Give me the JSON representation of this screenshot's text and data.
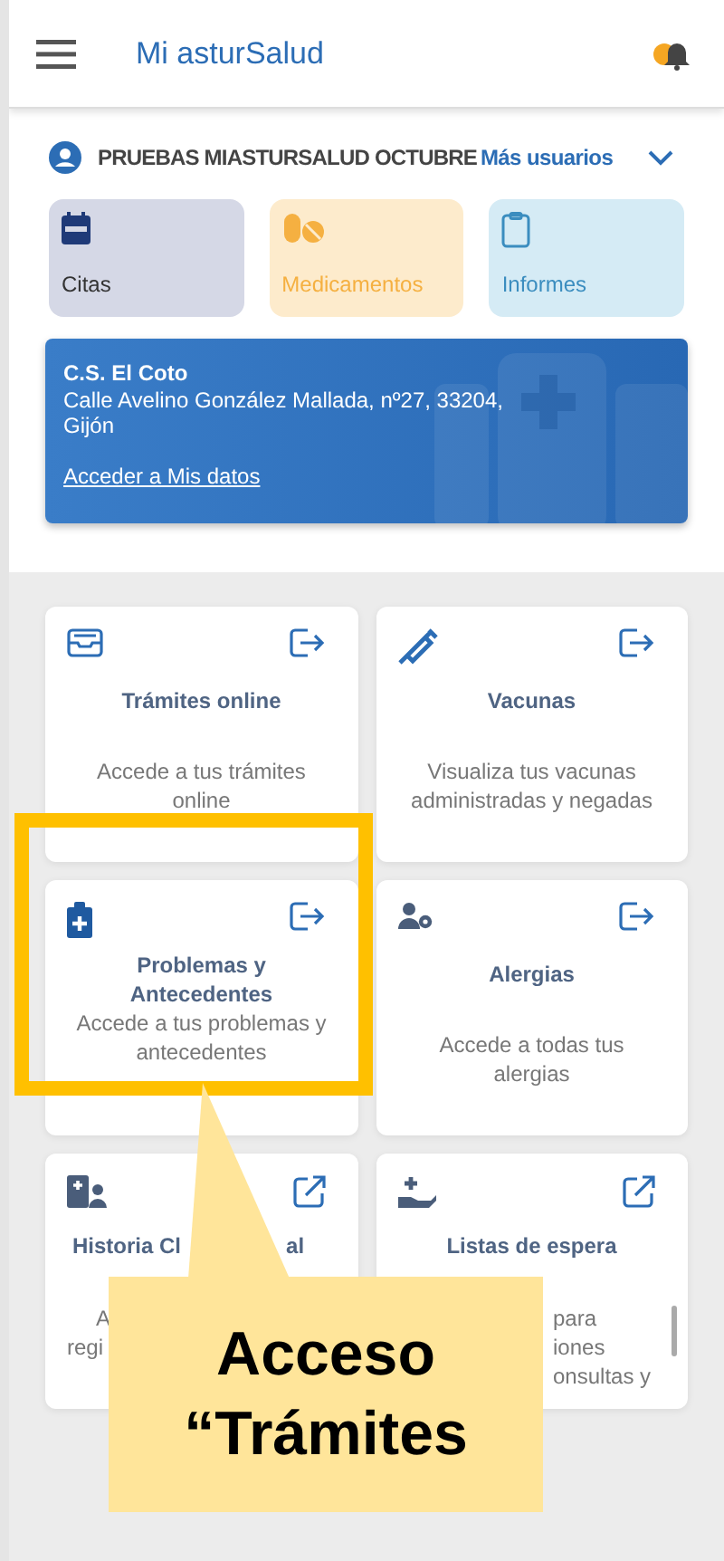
{
  "header": {
    "title": "Mi asturSalud"
  },
  "user": {
    "name": "PRUEBAS MIASTURSALUD OCTUBRE",
    "more_users": "Más usuarios"
  },
  "shortcuts": [
    {
      "label": "Citas",
      "color": "#1f3a78"
    },
    {
      "label": "Medicamentos",
      "color": "#f5b041"
    },
    {
      "label": "Informes",
      "color": "#3b8dbf"
    }
  ],
  "health_center": {
    "name": "C.S. El Coto",
    "address": "Calle Avelino González Mallada, nº27, 33204, Gijón",
    "link": "Acceder a Mis datos"
  },
  "cards": [
    {
      "kind": "internal",
      "title": [
        "Trámites online"
      ],
      "description": [
        "Accede a tus trámites",
        "online"
      ]
    },
    {
      "kind": "internal",
      "title": [
        "Vacunas"
      ],
      "description": [
        "Visualiza tus vacunas",
        "administradas y negadas"
      ]
    },
    {
      "kind": "internal",
      "title": [
        "Problemas y",
        "Antecedentes"
      ],
      "description": [
        "Accede a tus problemas y",
        "antecedentes"
      ]
    },
    {
      "kind": "internal",
      "title": [
        "Alergias"
      ],
      "description": [
        "Accede a todas tus",
        "alergias"
      ]
    },
    {
      "kind": "external",
      "title": [
        "Historia Cl",
        "al"
      ],
      "description": [
        "A",
        "regi"
      ]
    },
    {
      "kind": "external",
      "title": [
        "Listas de espera"
      ],
      "description": [
        "para",
        "iones",
        "onsultas y"
      ]
    }
  ],
  "callout": {
    "lines": [
      "Acceso",
      "“Trámites"
    ]
  }
}
